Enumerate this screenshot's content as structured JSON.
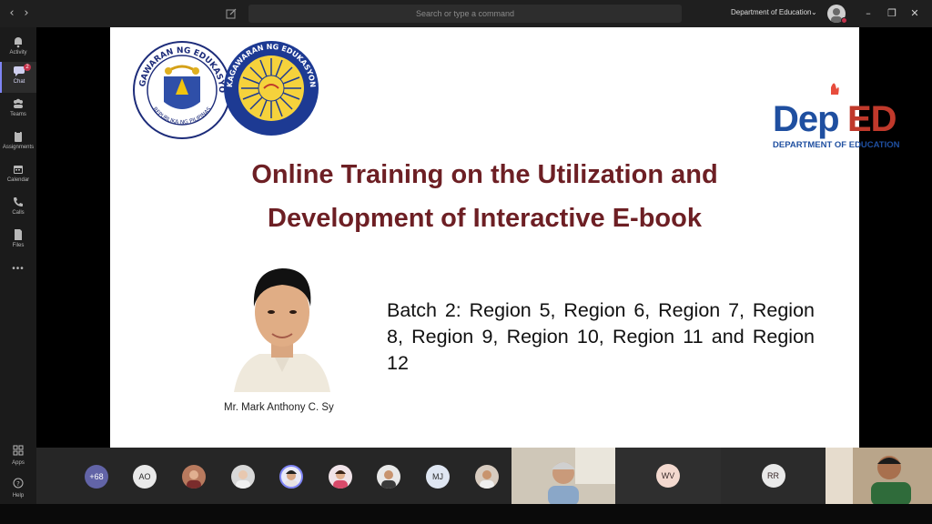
{
  "topbar": {
    "search_placeholder": "Search or type a command",
    "org_name": "Department of Education"
  },
  "rail": {
    "items": [
      {
        "label": "Activity",
        "icon": "bell-icon"
      },
      {
        "label": "Chat",
        "icon": "chat-icon",
        "badge": "2",
        "active": true
      },
      {
        "label": "Teams",
        "icon": "teams-icon"
      },
      {
        "label": "Assignments",
        "icon": "assignments-icon"
      },
      {
        "label": "Calendar",
        "icon": "calendar-icon"
      },
      {
        "label": "Calls",
        "icon": "phone-icon"
      },
      {
        "label": "Files",
        "icon": "file-icon"
      }
    ],
    "more": "•••",
    "apps_label": "Apps",
    "help_label": "Help"
  },
  "slide": {
    "seal_text_top": "KAGAWARAN NG EDUKASYON",
    "seal_text_bottom": "REPUBLIKA NG PILIPINAS",
    "seal2_text": "KAGAWARAN NG EDUKASYON",
    "logo_text": "DepED",
    "logo_sub": "DEPARTMENT OF EDUCATION",
    "title_line1": "Online Training on the Utilization and",
    "title_line2": "Development of Interactive E-book",
    "batch_text": "Batch 2: Region 5, Region 6, Region 7, Region 8, Region 9, Region 10, Region 11 and Region 12",
    "speaker_caption": "Mr. Mark Anthony C. Sy"
  },
  "participants": {
    "overflow_count": "+68",
    "bubbles": [
      "AO",
      "MJ"
    ],
    "tiles": [
      "WV",
      "RR"
    ]
  },
  "colors": {
    "title": "#6d1f24",
    "accent": "#7f85f5",
    "badge": "#c4314b"
  }
}
